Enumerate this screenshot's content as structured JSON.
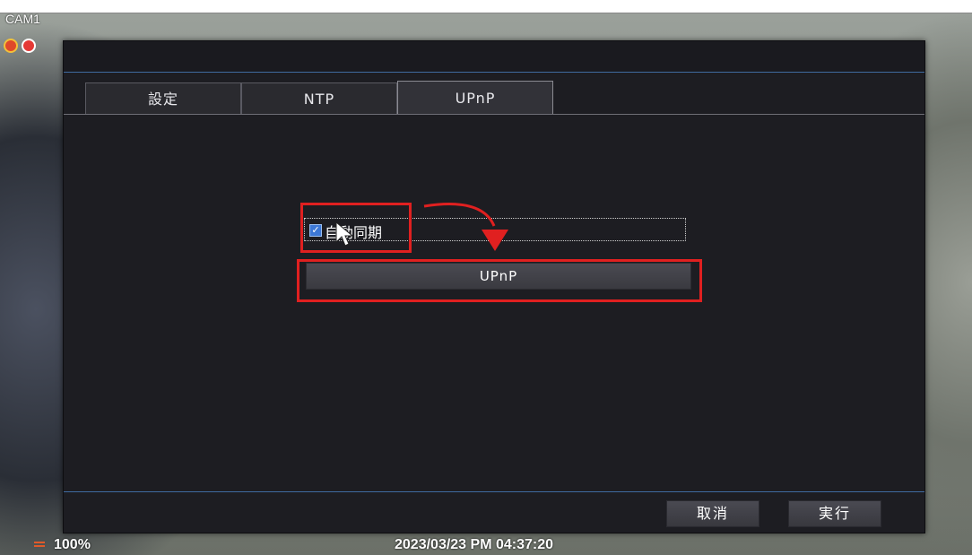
{
  "camera": {
    "label": "CAM1"
  },
  "tabs": [
    {
      "label": "設定"
    },
    {
      "label": "NTP"
    },
    {
      "label": "UPnP"
    }
  ],
  "auto_sync": {
    "label": "自動同期",
    "checked": true
  },
  "upnp_button": {
    "label": "UPnP"
  },
  "footer": {
    "cancel_label": "取消",
    "execute_label": "実行"
  },
  "status": {
    "zoom": "100%",
    "datetime": "2023/03/23 PM 04:37:20"
  },
  "colors": {
    "highlight": "#e02020",
    "accent_line": "#3f6aa0",
    "dialog_bg": "#1d1d22"
  }
}
